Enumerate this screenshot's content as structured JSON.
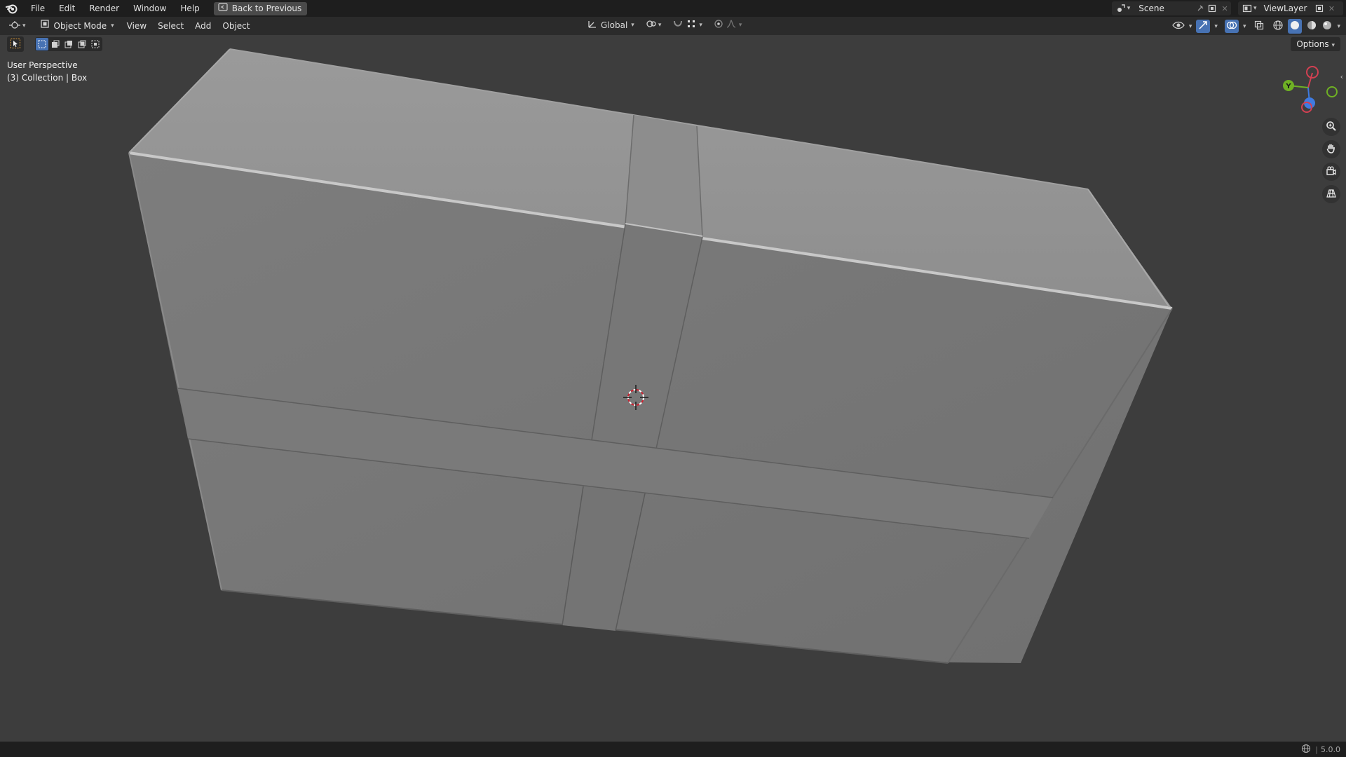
{
  "app": {
    "title": "Blender",
    "version": "5.0.0"
  },
  "topbar": {
    "menus": [
      "File",
      "Edit",
      "Render",
      "Window",
      "Help"
    ],
    "back_button": "Back to Previous",
    "scene_name": "Scene",
    "view_layer": "ViewLayer"
  },
  "header": {
    "mode": "Object Mode",
    "menus": [
      "View",
      "Select",
      "Add",
      "Object"
    ],
    "transform_orientation": "Global",
    "options_label": "Options"
  },
  "viewport": {
    "view_name": "User Perspective",
    "collection_info": "(3) Collection | Box",
    "gizmo_axes": [
      "Y"
    ]
  },
  "colors": {
    "accent": "#4772b3",
    "axis_x": "#d34052",
    "axis_y": "#6fb124",
    "axis_z": "#3f7be0",
    "background": "#3d3d3d"
  },
  "icons": [
    "blender-logo-icon",
    "back-icon",
    "scene-icon",
    "pin-icon",
    "new-scene-icon",
    "view-layer-icon",
    "editor-type-icon",
    "object-mode-icon",
    "global-orientation-icon",
    "pivot-icon",
    "snap-icon",
    "proportional-icon",
    "visibility-icon",
    "gizmo-icon",
    "overlay-icon",
    "xray-icon",
    "shading-wire-icon",
    "shading-solid-icon",
    "shading-material-icon",
    "shading-render-icon",
    "zoom-icon",
    "pan-hand-icon",
    "camera-icon",
    "grid-icon",
    "select-tool-icon",
    "network-icon"
  ]
}
